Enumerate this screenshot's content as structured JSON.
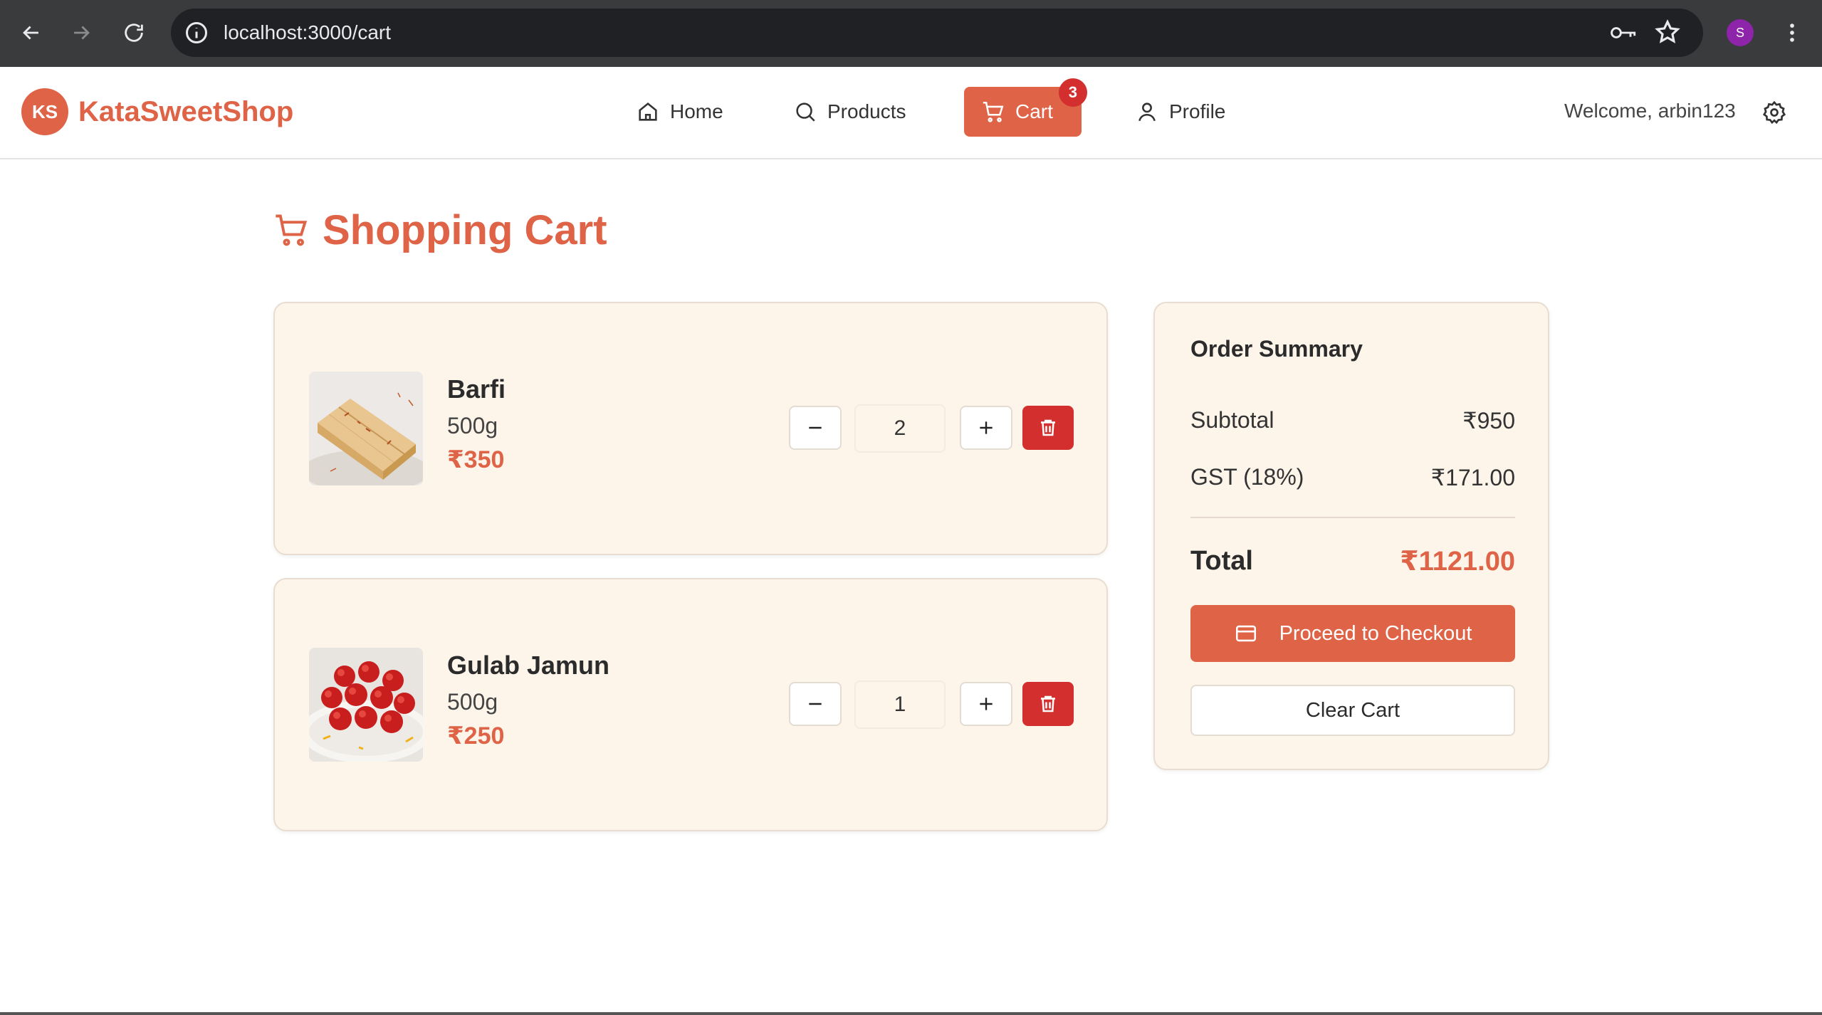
{
  "browser": {
    "url": "localhost:3000/cart",
    "profile_initial": "S"
  },
  "header": {
    "brand_logo_text": "KS",
    "brand_name": "KataSweetShop",
    "nav": {
      "home": "Home",
      "products": "Products",
      "cart": "Cart",
      "cart_count": "3",
      "profile": "Profile"
    },
    "welcome": "Welcome, arbin123"
  },
  "page": {
    "title": "Shopping Cart"
  },
  "cart": {
    "items": [
      {
        "name": "Barfi",
        "weight": "500g",
        "price": "₹350",
        "quantity": "2",
        "image": "barfi-sweets"
      },
      {
        "name": "Gulab Jamun",
        "weight": "500g",
        "price": "₹250",
        "quantity": "1",
        "image": "gulab-jamun-plate"
      }
    ]
  },
  "summary": {
    "title": "Order Summary",
    "subtotal_label": "Subtotal",
    "subtotal_value": "₹950",
    "gst_label": "GST (18%)",
    "gst_value": "₹171.00",
    "total_label": "Total",
    "total_value": "₹1121.00",
    "checkout_label": "Proceed to Checkout",
    "clear_label": "Clear Cart"
  },
  "colors": {
    "brand": "#df6346",
    "danger": "#d32f2f",
    "card_bg": "#fdf4ea"
  }
}
